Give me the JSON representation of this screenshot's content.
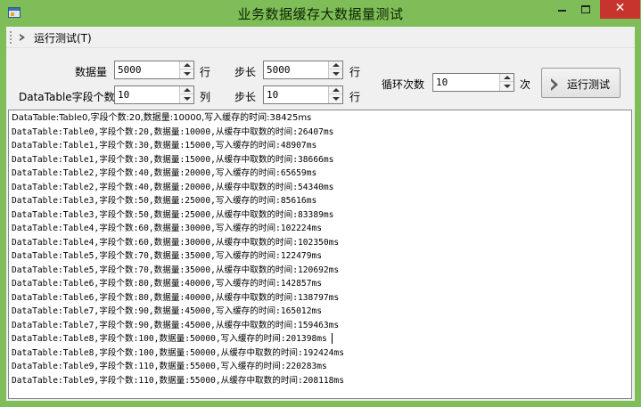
{
  "window": {
    "title": "业务数据缓存大数据量测试",
    "controls": {
      "minimize_icon": "minimize-icon",
      "maximize_icon": "maximize-icon",
      "close_glyph": "✕"
    }
  },
  "menu": {
    "run_test": "运行测试(T)"
  },
  "form": {
    "data_count_label": "数据量",
    "data_count_value": "5000",
    "data_count_unit": "行",
    "step1_label": "步长",
    "step1_value": "5000",
    "step1_unit": "行",
    "fields_label": "DataTable字段个数",
    "fields_value": "10",
    "fields_unit": "列",
    "step2_label": "步长",
    "step2_value": "10",
    "step2_unit": "行",
    "loop_label": "循环次数",
    "loop_value": "10",
    "loop_unit": "次",
    "run_button": "运行测试"
  },
  "output": {
    "lines": [
      "DataTable:Table0,字段个数:20,数据量:10000,写入缓存的时间:38425ms",
      "DataTable:Table0,字段个数:20,数据量:10000,从缓存中取数的时间:26407ms",
      "DataTable:Table1,字段个数:30,数据量:15000,写入缓存的时间:48907ms",
      "DataTable:Table1,字段个数:30,数据量:15000,从缓存中取数的时间:38666ms",
      "DataTable:Table2,字段个数:40,数据量:20000,写入缓存的时间:65659ms",
      "DataTable:Table2,字段个数:40,数据量:20000,从缓存中取数的时间:54340ms",
      "DataTable:Table3,字段个数:50,数据量:25000,写入缓存的时间:85616ms",
      "DataTable:Table3,字段个数:50,数据量:25000,从缓存中取数的时间:83389ms",
      "DataTable:Table4,字段个数:60,数据量:30000,写入缓存的时间:102224ms",
      "DataTable:Table4,字段个数:60,数据量:30000,从缓存中取数的时间:102350ms",
      "DataTable:Table5,字段个数:70,数据量:35000,写入缓存的时间:122479ms",
      "DataTable:Table5,字段个数:70,数据量:35000,从缓存中取数的时间:120692ms",
      "DataTable:Table6,字段个数:80,数据量:40000,写入缓存的时间:142857ms",
      "DataTable:Table6,字段个数:80,数据量:40000,从缓存中取数的时间:138797ms",
      "DataTable:Table7,字段个数:90,数据量:45000,写入缓存的时间:165012ms",
      "DataTable:Table7,字段个数:90,数据量:45000,从缓存中取数的时间:159463ms",
      "DataTable:Table8,字段个数:100,数据量:50000,写入缓存的时间:201398ms",
      "DataTable:Table8,字段个数:100,数据量:50000,从缓存中取数的时间:192424ms",
      "DataTable:Table9,字段个数:110,数据量:55000,写入缓存的时间:220283ms",
      "DataTable:Table9,字段个数:110,数据量:55000,从缓存中取数的时间:208118ms"
    ]
  },
  "colors": {
    "frame": "#7ebd58",
    "close_button": "#c7342e",
    "client_bg": "#f0f0f0"
  }
}
